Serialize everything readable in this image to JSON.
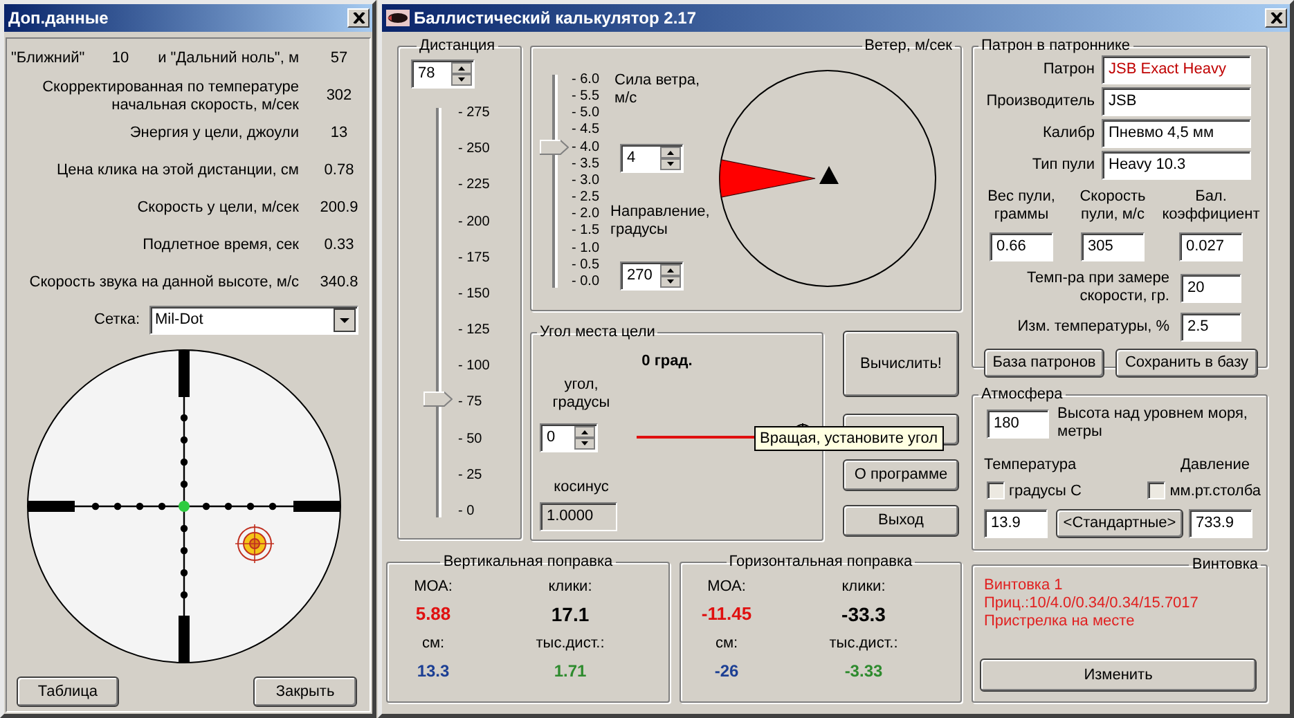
{
  "extra_window": {
    "title": "Доп.данные",
    "zero_row": {
      "near_label": "\"Ближний\"",
      "near_value": "10",
      "far_label": "и \"Дальний ноль\", м",
      "far_value": "57"
    },
    "stats": [
      {
        "label": "Скорректированная по температуре начальная скорость, м/сек",
        "value": "302"
      },
      {
        "label": "Энергия у цели, джоули",
        "value": "13"
      },
      {
        "label": "Цена клика на этой дистанции, см",
        "value": "0.78"
      },
      {
        "label": "Скорость у цели, м/сек",
        "value": "200.9"
      },
      {
        "label": "Подлетное время, сек",
        "value": "0.33"
      },
      {
        "label": "Скорость звука на данной высоте, м/с",
        "value": "340.8"
      }
    ],
    "reticle": {
      "label": "Сетка:",
      "value": "Mil-Dot"
    },
    "buttons": [
      "Таблица",
      "Закрыть"
    ]
  },
  "main_window": {
    "title": "Баллистический калькулятор 2.17"
  },
  "distance": {
    "title": "Дистанция",
    "value": "78",
    "level": 0.284,
    "ticks": [
      "- 275",
      "- 250",
      "- 225",
      "- 200",
      "- 175",
      "- 150",
      "- 125",
      "- 100",
      "- 75",
      "- 50",
      "- 25",
      "- 0"
    ]
  },
  "wind": {
    "title": "Ветер, м/сек",
    "level": 0.667,
    "ticks": [
      "- 6.0",
      "- 5.5",
      "- 5.0",
      "- 4.5",
      "- 4.0",
      "- 3.5",
      "- 3.0",
      "- 2.5",
      "- 2.0",
      "- 1.5",
      "- 1.0",
      "- 0.5",
      "- 0.0"
    ],
    "speed_label": "Сила ветра, м/с",
    "speed": "4",
    "direction_label": "Направление, градусы",
    "direction": "270"
  },
  "angle": {
    "title": "Угол места цели",
    "readout": "0 град.",
    "angle_label": "угол, градусы",
    "angle": "0",
    "cosine_label": "косинус",
    "cosine": "1.0000",
    "tooltip": "Вращая, установите угол"
  },
  "actions": [
    {
      "kind": "big",
      "label": "Вычислить!"
    },
    {
      "kind": "covered"
    },
    {
      "kind": "normal",
      "label": "О программе"
    },
    {
      "kind": "normal",
      "label": "Выход"
    }
  ],
  "corrections": [
    {
      "title": "Вертикальная поправка",
      "items": [
        {
          "label": "МОА:",
          "value": "5.88"
        },
        {
          "label": "клики:",
          "value": "17.1"
        },
        {
          "label": "см:",
          "value": "13.3"
        },
        {
          "label": "тыс.дист.:",
          "value": "1.71"
        }
      ]
    },
    {
      "title": "Горизонтальная поправка",
      "items": [
        {
          "label": "МОА:",
          "value": "-11.45"
        },
        {
          "label": "клики:",
          "value": "-33.3"
        },
        {
          "label": "см:",
          "value": "-26"
        },
        {
          "label": "тыс.дист.:",
          "value": "-3.33"
        }
      ]
    }
  ],
  "cartridge": {
    "title": "Патрон в патроннике",
    "fields": [
      {
        "label": "Патрон",
        "value": "JSB Exact Heavy",
        "color": "#c00000"
      },
      {
        "label": "Производитель",
        "value": "JSB",
        "color": "#000000"
      },
      {
        "label": "Калибр",
        "value": "Пневмо 4,5 мм",
        "color": "#000000"
      },
      {
        "label": "Тип пули",
        "value": "Heavy 10.3",
        "color": "#000000"
      }
    ],
    "columns": [
      {
        "label": "Вес пули, граммы",
        "value": "0.66"
      },
      {
        "label": "Скорость пули, м/с",
        "value": "305"
      },
      {
        "label": "Бал. коэффициент",
        "value": "0.027"
      }
    ],
    "temp_label": "Темп-ра при замере скорости, гр.",
    "temp": "20",
    "change_label": "Изм. температуры, %",
    "change": "2.5",
    "buttons": [
      "База патронов",
      "Сохранить в базу"
    ]
  },
  "atmosphere": {
    "title": "Атмосфера",
    "altitude": "180",
    "altitude_label": "Высота над уровнем моря, метры",
    "temp_title": "Температура",
    "pressure_title": "Давление",
    "checks": [
      {
        "label": "градусы С",
        "checked": false
      },
      {
        "label": "мм.рт.столба",
        "checked": false
      }
    ],
    "temperature": "13.9",
    "standard_button": "<Стандартные>",
    "pressure": "733.9"
  },
  "rifle": {
    "title": "Винтовка",
    "lines": [
      "Винтовка 1",
      "Приц.:10/4.0/0.34/0.34/15.7017",
      "Пристрелка на месте"
    ],
    "button": "Изменить"
  }
}
